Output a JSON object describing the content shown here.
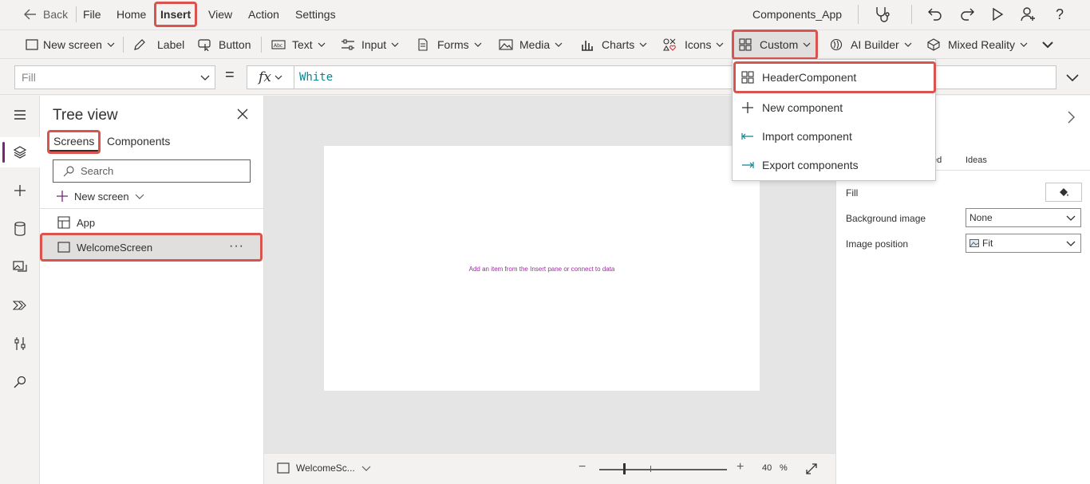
{
  "topbar": {
    "back": "Back",
    "menu": [
      "File",
      "Home",
      "Insert",
      "View",
      "Action",
      "Settings"
    ],
    "app_name": "Components_App"
  },
  "ribbon": {
    "new_screen": "New screen",
    "label": "Label",
    "button": "Button",
    "text": "Text",
    "input": "Input",
    "forms": "Forms",
    "media": "Media",
    "charts": "Charts",
    "icons": "Icons",
    "custom": "Custom",
    "ai_builder": "AI Builder",
    "mixed_reality": "Mixed Reality"
  },
  "formula": {
    "property": "Fill",
    "equals": "=",
    "fx": "fx",
    "value": "White"
  },
  "tree": {
    "title": "Tree view",
    "tab_screens": "Screens",
    "tab_components": "Components",
    "search_placeholder": "Search",
    "new_screen": "New screen",
    "app": "App",
    "welcome": "WelcomeScreen",
    "more": "···"
  },
  "canvas": {
    "hint": "Add an item from the Insert pane or connect to data",
    "screen_select": "WelcomeSc...",
    "zoom_minus": "−",
    "zoom_plus": "+",
    "zoom_value": "40",
    "zoom_pct": "%",
    "zoom_level": 0.2
  },
  "props": {
    "tab_adv_partial": "ed",
    "tab_ideas": "Ideas",
    "fill_label": "Fill",
    "bg_image_label": "Background image",
    "bg_image_value": "None",
    "img_pos_label": "Image position",
    "img_pos_value": "Fit"
  },
  "custom_menu": {
    "items": [
      "HeaderComponent",
      "New component",
      "Import component",
      "Export components"
    ]
  },
  "colors": {
    "accent": "#742774",
    "highlight": "#d9534f",
    "formula_text": "#0c8591"
  }
}
